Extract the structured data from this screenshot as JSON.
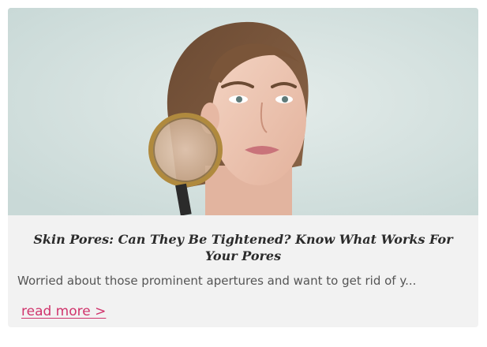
{
  "card": {
    "image": {
      "alt_semantic": "woman-with-magnifying-glass-image"
    },
    "title": "Skin Pores: Can They Be Tightened? Know What Works For Your Pores",
    "excerpt": "Worried about those prominent apertures and want to get rid of y...",
    "read_more_label": "read more >"
  },
  "colors": {
    "link": "#d0346c",
    "card_background": "#f2f2f2",
    "title_text": "#2b2b2b",
    "body_text": "#555555"
  }
}
